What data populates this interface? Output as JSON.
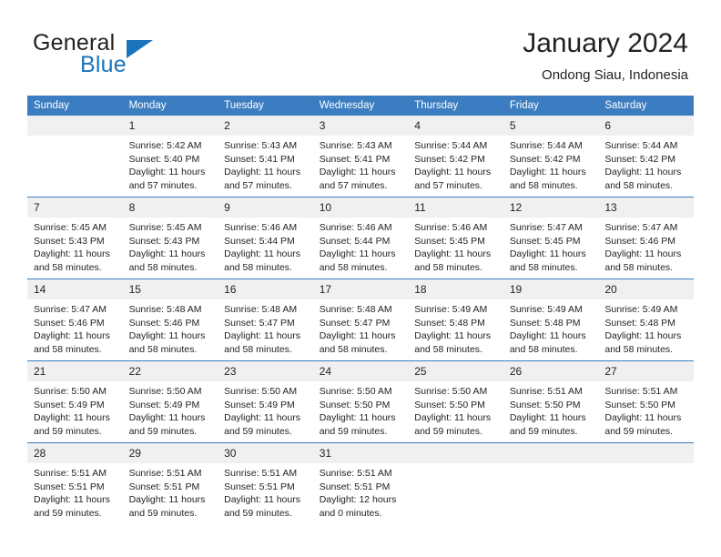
{
  "brand": {
    "name_top": "General",
    "name_bottom": "Blue",
    "accent_color": "#1b75bc",
    "triangle_icon": "triangle-icon"
  },
  "header": {
    "title": "January 2024",
    "subtitle": "Ondong Siau, Indonesia"
  },
  "calendar": {
    "header_bg": "#3b7dc0",
    "daynum_bg": "#f0f0f0",
    "weekday_headers": [
      "Sunday",
      "Monday",
      "Tuesday",
      "Wednesday",
      "Thursday",
      "Friday",
      "Saturday"
    ],
    "weeks": [
      [
        {
          "day": "",
          "empty": true,
          "sunrise": "",
          "sunset": "",
          "daylight_1": "",
          "daylight_2": ""
        },
        {
          "day": "1",
          "empty": false,
          "sunrise": "Sunrise: 5:42 AM",
          "sunset": "Sunset: 5:40 PM",
          "daylight_1": "Daylight: 11 hours",
          "daylight_2": "and 57 minutes."
        },
        {
          "day": "2",
          "empty": false,
          "sunrise": "Sunrise: 5:43 AM",
          "sunset": "Sunset: 5:41 PM",
          "daylight_1": "Daylight: 11 hours",
          "daylight_2": "and 57 minutes."
        },
        {
          "day": "3",
          "empty": false,
          "sunrise": "Sunrise: 5:43 AM",
          "sunset": "Sunset: 5:41 PM",
          "daylight_1": "Daylight: 11 hours",
          "daylight_2": "and 57 minutes."
        },
        {
          "day": "4",
          "empty": false,
          "sunrise": "Sunrise: 5:44 AM",
          "sunset": "Sunset: 5:42 PM",
          "daylight_1": "Daylight: 11 hours",
          "daylight_2": "and 57 minutes."
        },
        {
          "day": "5",
          "empty": false,
          "sunrise": "Sunrise: 5:44 AM",
          "sunset": "Sunset: 5:42 PM",
          "daylight_1": "Daylight: 11 hours",
          "daylight_2": "and 58 minutes."
        },
        {
          "day": "6",
          "empty": false,
          "sunrise": "Sunrise: 5:44 AM",
          "sunset": "Sunset: 5:42 PM",
          "daylight_1": "Daylight: 11 hours",
          "daylight_2": "and 58 minutes."
        }
      ],
      [
        {
          "day": "7",
          "empty": false,
          "sunrise": "Sunrise: 5:45 AM",
          "sunset": "Sunset: 5:43 PM",
          "daylight_1": "Daylight: 11 hours",
          "daylight_2": "and 58 minutes."
        },
        {
          "day": "8",
          "empty": false,
          "sunrise": "Sunrise: 5:45 AM",
          "sunset": "Sunset: 5:43 PM",
          "daylight_1": "Daylight: 11 hours",
          "daylight_2": "and 58 minutes."
        },
        {
          "day": "9",
          "empty": false,
          "sunrise": "Sunrise: 5:46 AM",
          "sunset": "Sunset: 5:44 PM",
          "daylight_1": "Daylight: 11 hours",
          "daylight_2": "and 58 minutes."
        },
        {
          "day": "10",
          "empty": false,
          "sunrise": "Sunrise: 5:46 AM",
          "sunset": "Sunset: 5:44 PM",
          "daylight_1": "Daylight: 11 hours",
          "daylight_2": "and 58 minutes."
        },
        {
          "day": "11",
          "empty": false,
          "sunrise": "Sunrise: 5:46 AM",
          "sunset": "Sunset: 5:45 PM",
          "daylight_1": "Daylight: 11 hours",
          "daylight_2": "and 58 minutes."
        },
        {
          "day": "12",
          "empty": false,
          "sunrise": "Sunrise: 5:47 AM",
          "sunset": "Sunset: 5:45 PM",
          "daylight_1": "Daylight: 11 hours",
          "daylight_2": "and 58 minutes."
        },
        {
          "day": "13",
          "empty": false,
          "sunrise": "Sunrise: 5:47 AM",
          "sunset": "Sunset: 5:46 PM",
          "daylight_1": "Daylight: 11 hours",
          "daylight_2": "and 58 minutes."
        }
      ],
      [
        {
          "day": "14",
          "empty": false,
          "sunrise": "Sunrise: 5:47 AM",
          "sunset": "Sunset: 5:46 PM",
          "daylight_1": "Daylight: 11 hours",
          "daylight_2": "and 58 minutes."
        },
        {
          "day": "15",
          "empty": false,
          "sunrise": "Sunrise: 5:48 AM",
          "sunset": "Sunset: 5:46 PM",
          "daylight_1": "Daylight: 11 hours",
          "daylight_2": "and 58 minutes."
        },
        {
          "day": "16",
          "empty": false,
          "sunrise": "Sunrise: 5:48 AM",
          "sunset": "Sunset: 5:47 PM",
          "daylight_1": "Daylight: 11 hours",
          "daylight_2": "and 58 minutes."
        },
        {
          "day": "17",
          "empty": false,
          "sunrise": "Sunrise: 5:48 AM",
          "sunset": "Sunset: 5:47 PM",
          "daylight_1": "Daylight: 11 hours",
          "daylight_2": "and 58 minutes."
        },
        {
          "day": "18",
          "empty": false,
          "sunrise": "Sunrise: 5:49 AM",
          "sunset": "Sunset: 5:48 PM",
          "daylight_1": "Daylight: 11 hours",
          "daylight_2": "and 58 minutes."
        },
        {
          "day": "19",
          "empty": false,
          "sunrise": "Sunrise: 5:49 AM",
          "sunset": "Sunset: 5:48 PM",
          "daylight_1": "Daylight: 11 hours",
          "daylight_2": "and 58 minutes."
        },
        {
          "day": "20",
          "empty": false,
          "sunrise": "Sunrise: 5:49 AM",
          "sunset": "Sunset: 5:48 PM",
          "daylight_1": "Daylight: 11 hours",
          "daylight_2": "and 58 minutes."
        }
      ],
      [
        {
          "day": "21",
          "empty": false,
          "sunrise": "Sunrise: 5:50 AM",
          "sunset": "Sunset: 5:49 PM",
          "daylight_1": "Daylight: 11 hours",
          "daylight_2": "and 59 minutes."
        },
        {
          "day": "22",
          "empty": false,
          "sunrise": "Sunrise: 5:50 AM",
          "sunset": "Sunset: 5:49 PM",
          "daylight_1": "Daylight: 11 hours",
          "daylight_2": "and 59 minutes."
        },
        {
          "day": "23",
          "empty": false,
          "sunrise": "Sunrise: 5:50 AM",
          "sunset": "Sunset: 5:49 PM",
          "daylight_1": "Daylight: 11 hours",
          "daylight_2": "and 59 minutes."
        },
        {
          "day": "24",
          "empty": false,
          "sunrise": "Sunrise: 5:50 AM",
          "sunset": "Sunset: 5:50 PM",
          "daylight_1": "Daylight: 11 hours",
          "daylight_2": "and 59 minutes."
        },
        {
          "day": "25",
          "empty": false,
          "sunrise": "Sunrise: 5:50 AM",
          "sunset": "Sunset: 5:50 PM",
          "daylight_1": "Daylight: 11 hours",
          "daylight_2": "and 59 minutes."
        },
        {
          "day": "26",
          "empty": false,
          "sunrise": "Sunrise: 5:51 AM",
          "sunset": "Sunset: 5:50 PM",
          "daylight_1": "Daylight: 11 hours",
          "daylight_2": "and 59 minutes."
        },
        {
          "day": "27",
          "empty": false,
          "sunrise": "Sunrise: 5:51 AM",
          "sunset": "Sunset: 5:50 PM",
          "daylight_1": "Daylight: 11 hours",
          "daylight_2": "and 59 minutes."
        }
      ],
      [
        {
          "day": "28",
          "empty": false,
          "sunrise": "Sunrise: 5:51 AM",
          "sunset": "Sunset: 5:51 PM",
          "daylight_1": "Daylight: 11 hours",
          "daylight_2": "and 59 minutes."
        },
        {
          "day": "29",
          "empty": false,
          "sunrise": "Sunrise: 5:51 AM",
          "sunset": "Sunset: 5:51 PM",
          "daylight_1": "Daylight: 11 hours",
          "daylight_2": "and 59 minutes."
        },
        {
          "day": "30",
          "empty": false,
          "sunrise": "Sunrise: 5:51 AM",
          "sunset": "Sunset: 5:51 PM",
          "daylight_1": "Daylight: 11 hours",
          "daylight_2": "and 59 minutes."
        },
        {
          "day": "31",
          "empty": false,
          "sunrise": "Sunrise: 5:51 AM",
          "sunset": "Sunset: 5:51 PM",
          "daylight_1": "Daylight: 12 hours",
          "daylight_2": "and 0 minutes."
        },
        {
          "day": "",
          "empty": true,
          "sunrise": "",
          "sunset": "",
          "daylight_1": "",
          "daylight_2": ""
        },
        {
          "day": "",
          "empty": true,
          "sunrise": "",
          "sunset": "",
          "daylight_1": "",
          "daylight_2": ""
        },
        {
          "day": "",
          "empty": true,
          "sunrise": "",
          "sunset": "",
          "daylight_1": "",
          "daylight_2": ""
        }
      ]
    ]
  }
}
